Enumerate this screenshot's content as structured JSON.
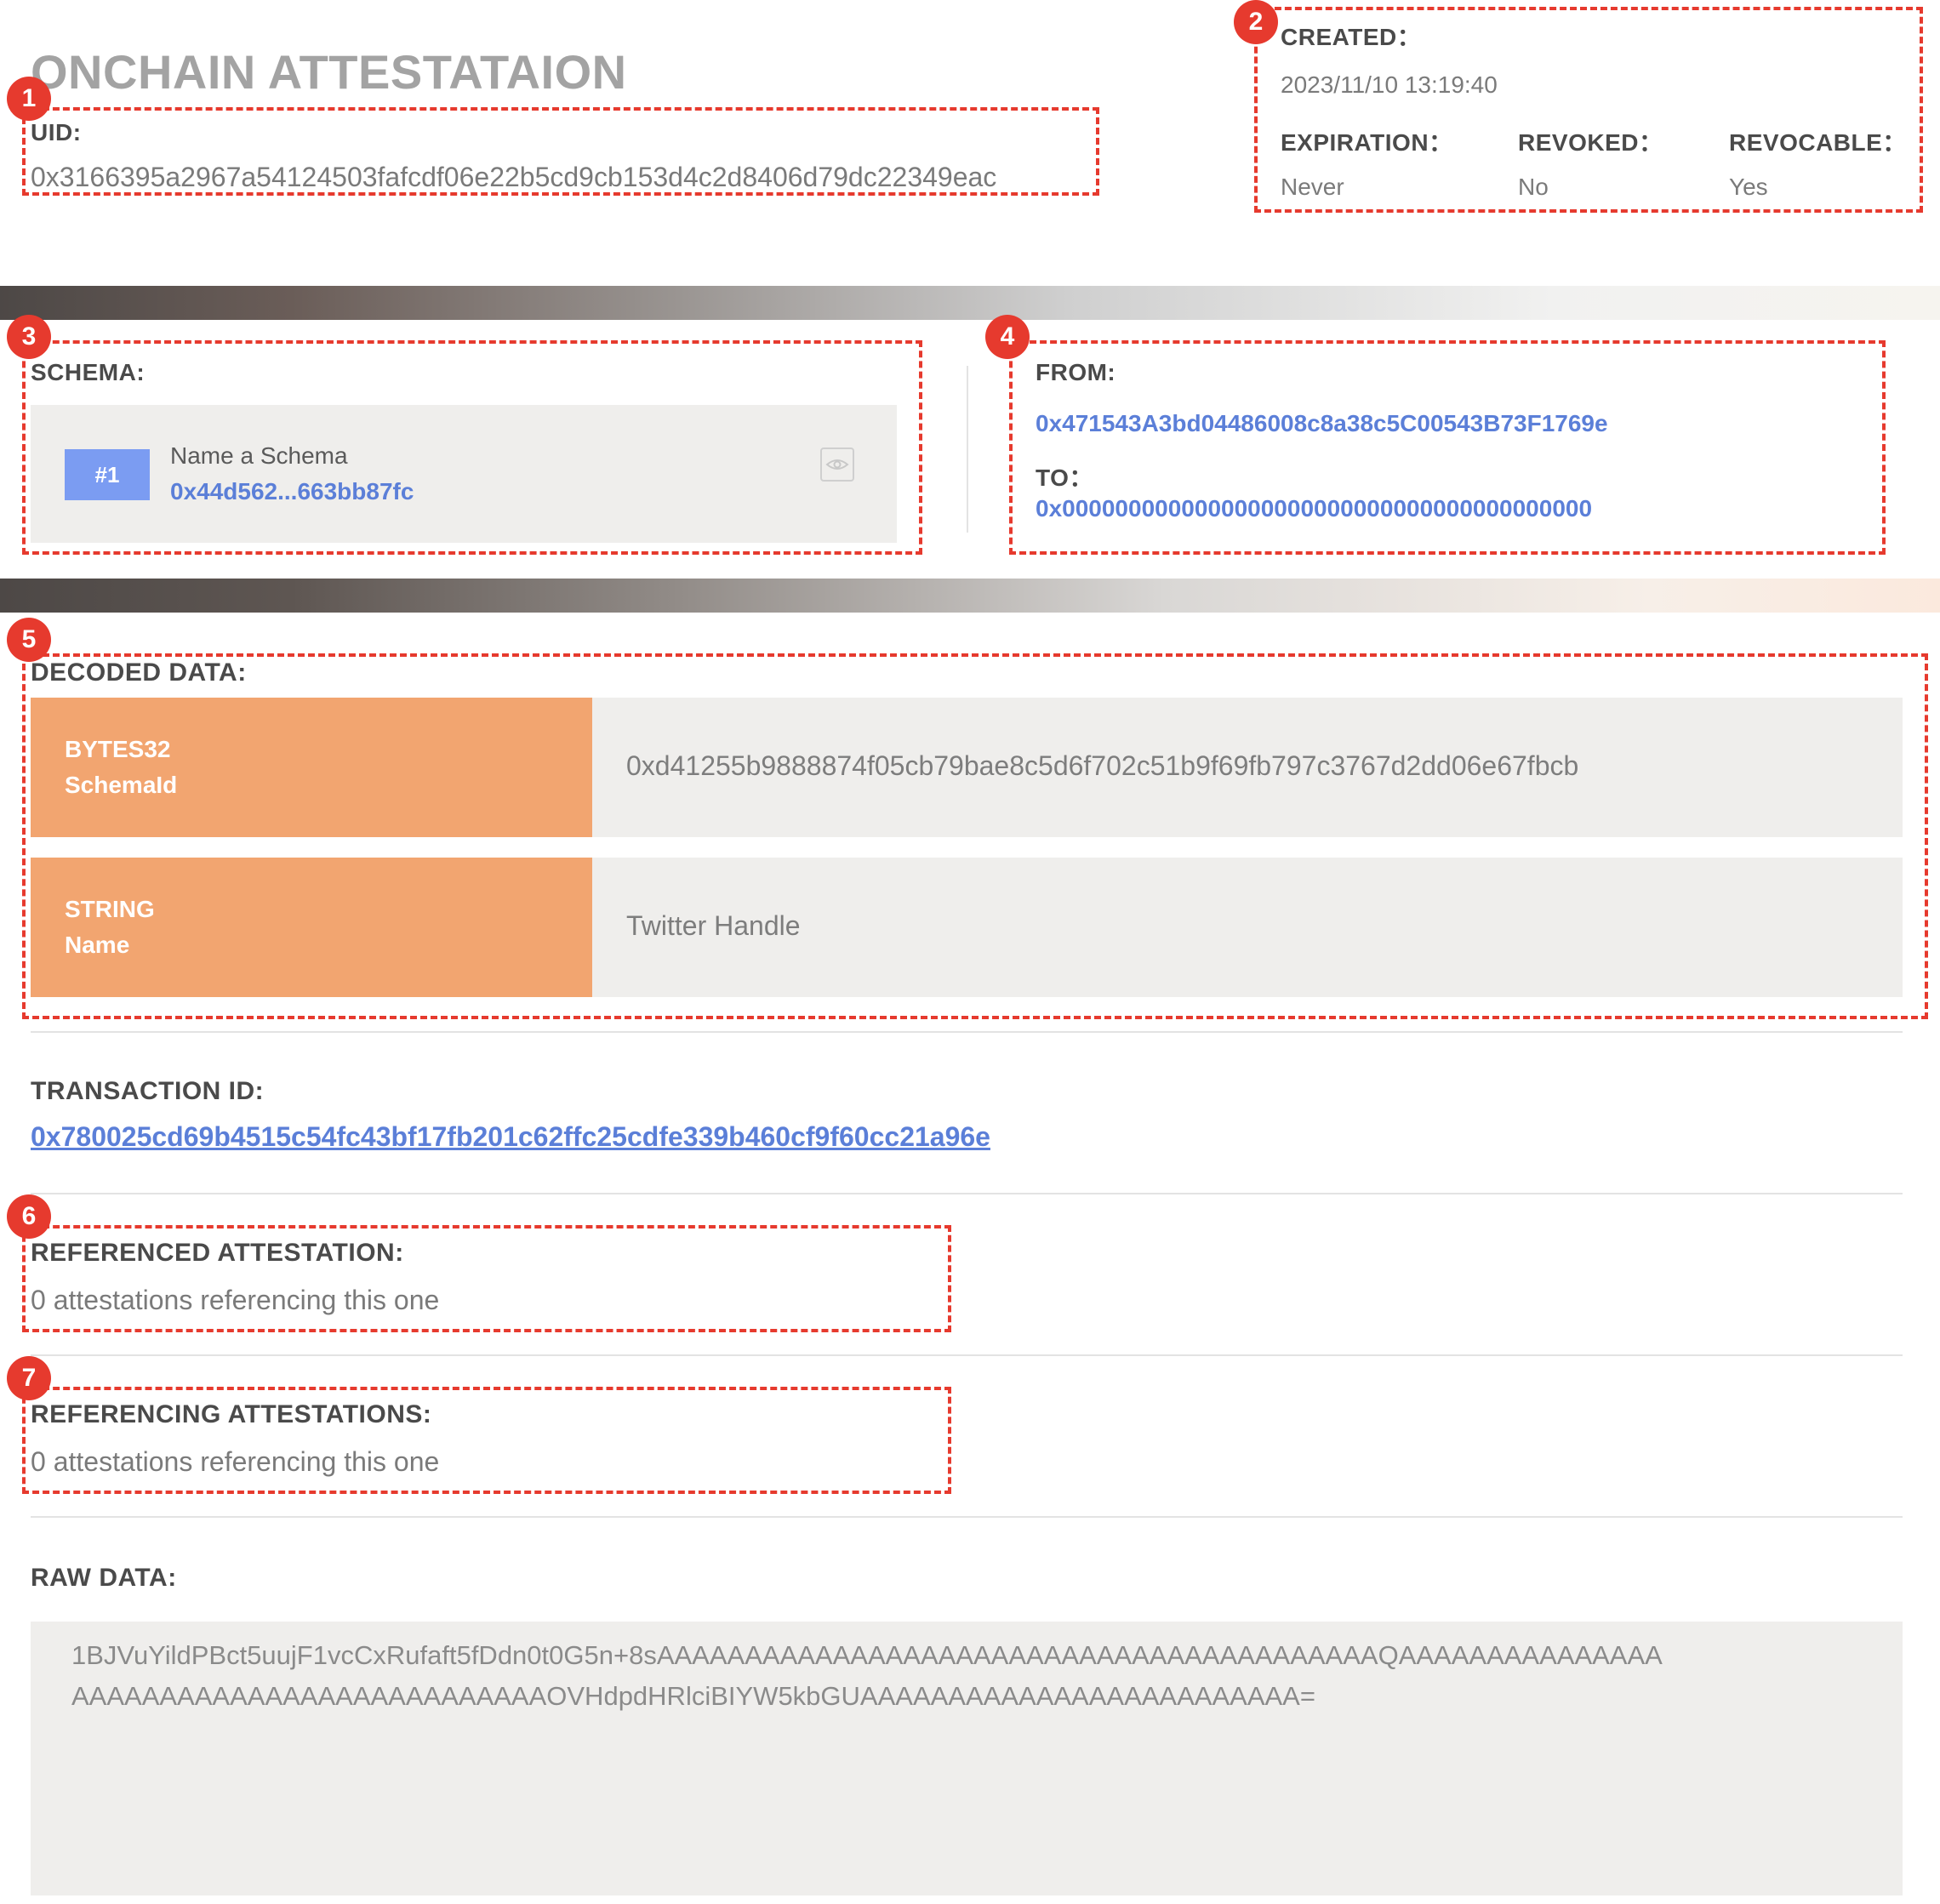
{
  "page_title": "ONCHAIN ATTESTATAION",
  "badges": [
    "1",
    "2",
    "3",
    "4",
    "5",
    "6",
    "7"
  ],
  "uid": {
    "label": "UID:",
    "value": "0x3166395a2967a54124503fafcdf06e22b5cd9cb153d4c2d8406d79dc22349eac"
  },
  "meta": {
    "created_label": "CREATED：",
    "created_value": "2023/11/10 13:19:40",
    "expiration_label": "EXPIRATION：",
    "expiration_value": "Never",
    "revoked_label": "REVOKED：",
    "revoked_value": "No",
    "revocable_label": "REVOCABLE：",
    "revocable_value": "Yes"
  },
  "schema": {
    "label": "SCHEMA:",
    "id_tag": "#1",
    "name": "Name a Schema",
    "address": "0x44d562...663bb87fc",
    "icon": "eye-icon"
  },
  "parties": {
    "from_label": "FROM:",
    "from_value": "0x471543A3bd04486008c8a38c5C00543B73F1769e",
    "to_label": "TO：",
    "to_value": "0x0000000000000000000000000000000000000000"
  },
  "decoded": {
    "label": "DECODED DATA:",
    "rows": [
      {
        "type": "BYTES32",
        "name": "SchemaId",
        "value": "0xd41255b9888874f05cb79bae8c5d6f702c51b9f69fb797c3767d2dd06e67fbcb"
      },
      {
        "type": "STRING",
        "name": "Name",
        "value": "Twitter Handle"
      }
    ]
  },
  "transaction": {
    "label": "TRANSACTION ID:",
    "value": "0x780025cd69b4515c54fc43bf17fb201c62ffc25cdfe339b460cf9f60cc21a96e"
  },
  "referenced": {
    "label": "REFERENCED ATTESTATION:",
    "value": "0 attestations referencing this one"
  },
  "referencing": {
    "label": "REFERENCING ATTESTATIONS:",
    "value": "0 attestations referencing this one"
  },
  "raw": {
    "label": "RAW DATA:",
    "line1": "1BJVuYildPBct5uujF1vcCxRufaft5fDdn0t0G5n+8sAAAAAAAAAAAAAAAAAAAAAAAAAAAAAAAAAAAAAAAAAQAAAAAAAAAAAAAAA",
    "line2": "AAAAAAAAAAAAAAAAAAAAAAAAAAAOVHdpdHRlciBIYW5kbGUAAAAAAAAAAAAAAAAAAAAAAAAA="
  },
  "colors": {
    "annotation": "#e63a2e",
    "link": "#5b7fd8",
    "schema_tag": "#7b9cf2",
    "type_cell": "#f2a570",
    "value_cell": "#efeeec"
  }
}
